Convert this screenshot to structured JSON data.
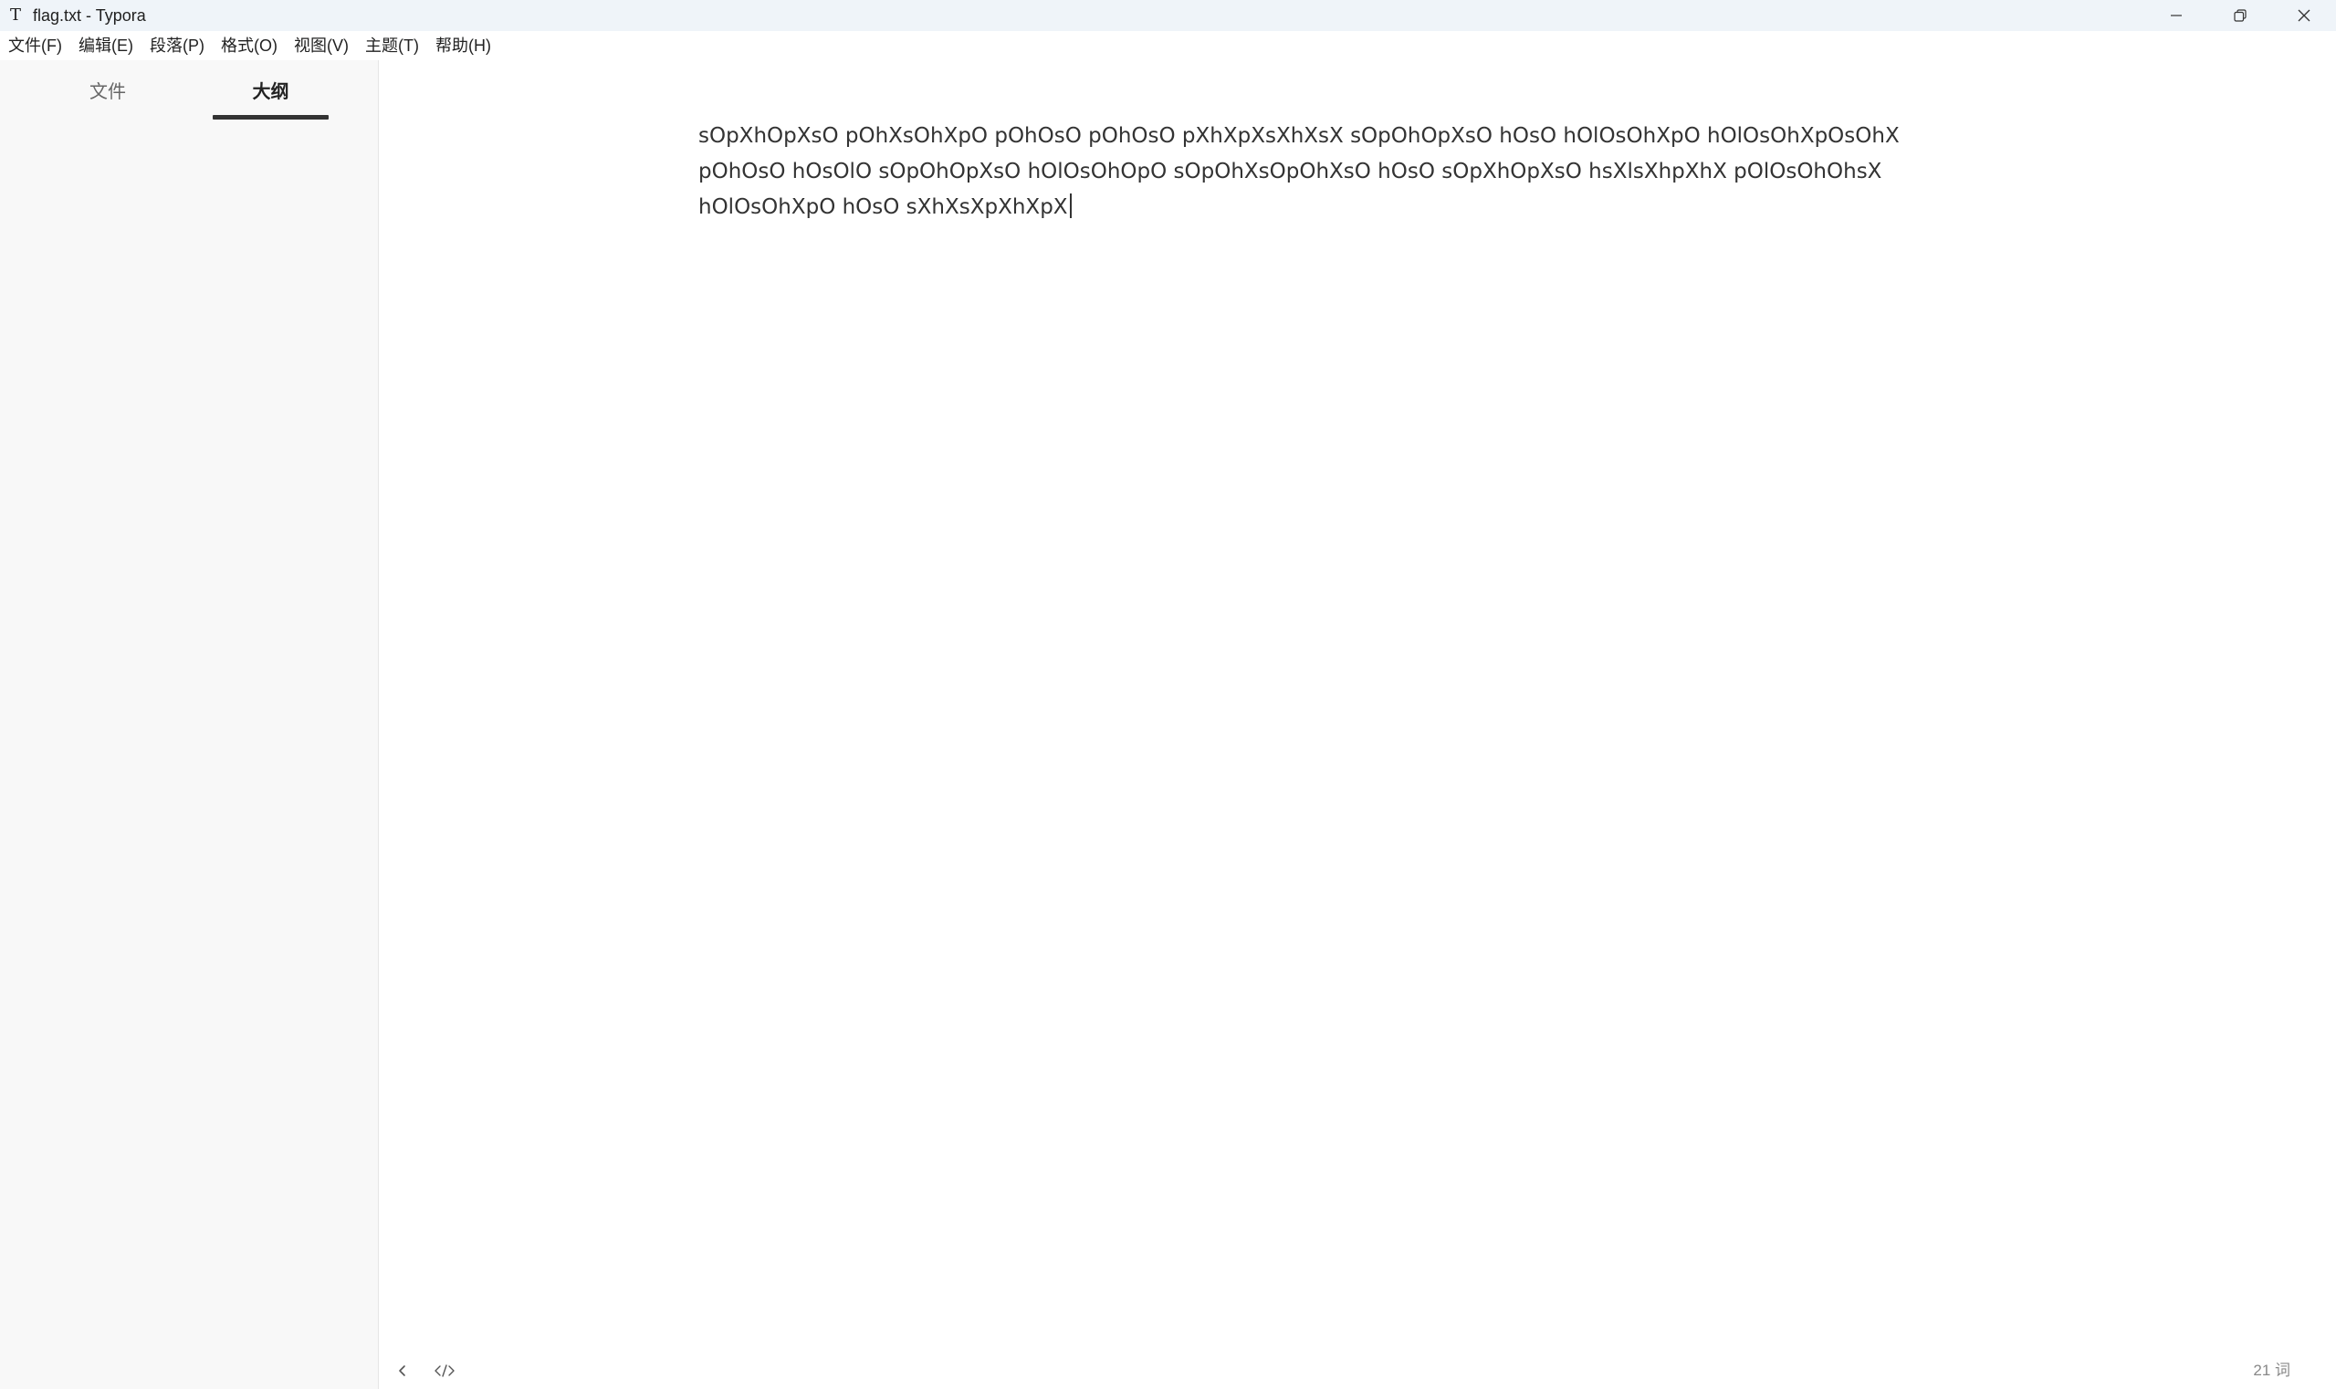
{
  "window": {
    "app_icon_glyph": "T",
    "title": "flag.txt - Typora",
    "controls": [
      "minimize-icon",
      "restore-icon",
      "close-icon"
    ]
  },
  "menu": {
    "items": [
      "文件(F)",
      "编辑(E)",
      "段落(P)",
      "格式(O)",
      "视图(V)",
      "主题(T)",
      "帮助(H)"
    ]
  },
  "sidebar": {
    "tabs": [
      {
        "label": "文件",
        "active": false
      },
      {
        "label": "大纲",
        "active": true
      }
    ]
  },
  "editor": {
    "content": "sOpXhOpXsO pOhXsOhXpO pOhOsO pOhOsO pXhXpXsXhXsX sOpOhOpXsO hOsO hOlOsOhXpO hOlOsOhXpOsOhX pOhOsO hOsOlO sOpOhOpXsO hOlOsOhOpO sOpOhXsOpOhXsO hOsO sOpXhOpXsO hsXlsXhpXhX pOlOsOhOhsX hOlOsOhXpO hOsO sXhXsXpXhXpX"
  },
  "statusbar": {
    "word_count": "21 词",
    "icons": [
      "chevron-left-icon",
      "source-code-icon"
    ]
  },
  "colors": {
    "titlebar_bg": "#eff4f9",
    "sidebar_bg": "#f8f8f8",
    "text": "#333333",
    "tab_underline": "#333333"
  }
}
